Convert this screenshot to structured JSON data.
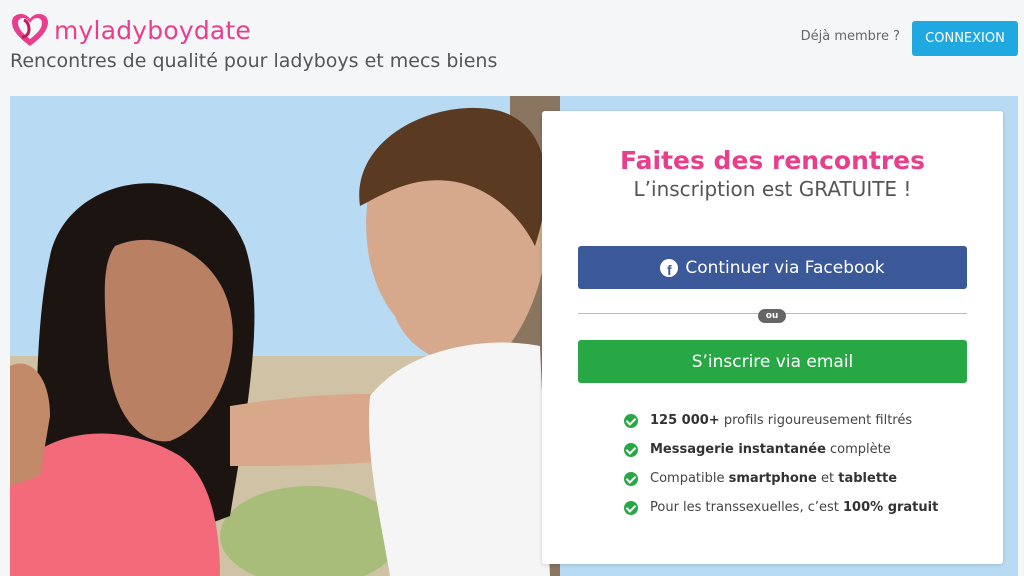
{
  "header": {
    "logo_text": "myladyboydate",
    "tagline": "Rencontres de qualité pour ladyboys et mecs biens",
    "member_label": "Déjà membre ?",
    "login_button": "CONNEXION"
  },
  "card": {
    "title": "Faites des rencontres",
    "subtitle": "L’inscription est GRATUITE !",
    "facebook_button": "Continuer via Facebook",
    "divider_label": "ou",
    "email_button": "S’inscrire via email",
    "features": [
      {
        "bold": "125 000+",
        "text": " profils rigoureusement filtrés"
      },
      {
        "bold": "Messagerie instantanée",
        "text": " complète"
      },
      {
        "pre": "Compatible ",
        "bold": "smartphone",
        "mid": " et ",
        "bold2": "tablette"
      },
      {
        "pre": "Pour les transsexuelles, c’est ",
        "bold": "100% gratuit"
      }
    ]
  },
  "colors": {
    "brand_pink": "#e83e8c",
    "facebook_blue": "#3b5998",
    "email_green": "#28a745",
    "login_blue": "#20a8e0"
  },
  "icons": {
    "logo": "heart-logo-icon",
    "facebook": "facebook-icon",
    "check": "check-circle-icon"
  }
}
